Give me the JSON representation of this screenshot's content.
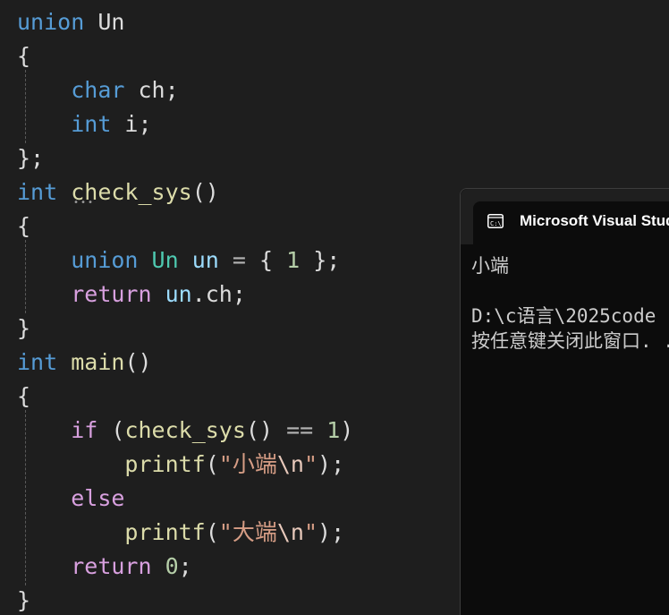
{
  "editor": {
    "lines": [
      [
        {
          "t": "union",
          "c": "kw"
        },
        {
          "t": " ",
          "c": "pl"
        },
        {
          "t": "Un",
          "c": "pl"
        }
      ],
      [
        {
          "t": "{",
          "c": "pl"
        }
      ],
      [
        {
          "t": "    ",
          "c": "pl"
        },
        {
          "t": "char",
          "c": "kw"
        },
        {
          "t": " ch;",
          "c": "pl"
        }
      ],
      [
        {
          "t": "    ",
          "c": "pl"
        },
        {
          "t": "int",
          "c": "kw"
        },
        {
          "t": " i;",
          "c": "pl"
        }
      ],
      [
        {
          "t": "};",
          "c": "pl"
        }
      ],
      [
        {
          "t": "int",
          "c": "kw"
        },
        {
          "t": " ",
          "c": "pl"
        },
        {
          "t": "check_sys",
          "c": "fn"
        },
        {
          "t": "()",
          "c": "pl"
        }
      ],
      [
        {
          "t": "{",
          "c": "pl"
        }
      ],
      [
        {
          "t": "    ",
          "c": "pl"
        },
        {
          "t": "union",
          "c": "kw"
        },
        {
          "t": " ",
          "c": "pl"
        },
        {
          "t": "Un",
          "c": "ty"
        },
        {
          "t": " ",
          "c": "pl"
        },
        {
          "t": "un",
          "c": "var"
        },
        {
          "t": " ",
          "c": "pl"
        },
        {
          "t": "=",
          "c": "op"
        },
        {
          "t": " { ",
          "c": "pl"
        },
        {
          "t": "1",
          "c": "num"
        },
        {
          "t": " };",
          "c": "pl"
        }
      ],
      [
        {
          "t": "    ",
          "c": "pl"
        },
        {
          "t": "return",
          "c": "ctl"
        },
        {
          "t": " ",
          "c": "pl"
        },
        {
          "t": "un",
          "c": "var"
        },
        {
          "t": ".ch;",
          "c": "pl"
        }
      ],
      [
        {
          "t": "}",
          "c": "pl"
        }
      ],
      [
        {
          "t": "int",
          "c": "kw"
        },
        {
          "t": " ",
          "c": "pl"
        },
        {
          "t": "main",
          "c": "fn"
        },
        {
          "t": "()",
          "c": "pl"
        }
      ],
      [
        {
          "t": "{",
          "c": "pl"
        }
      ],
      [
        {
          "t": "    ",
          "c": "pl"
        },
        {
          "t": "if",
          "c": "ctl"
        },
        {
          "t": " (",
          "c": "pl"
        },
        {
          "t": "check_sys",
          "c": "fn"
        },
        {
          "t": "() ",
          "c": "pl"
        },
        {
          "t": "==",
          "c": "op"
        },
        {
          "t": " ",
          "c": "pl"
        },
        {
          "t": "1",
          "c": "num"
        },
        {
          "t": ")",
          "c": "pl"
        }
      ],
      [
        {
          "t": "        ",
          "c": "pl"
        },
        {
          "t": "printf",
          "c": "fn"
        },
        {
          "t": "(",
          "c": "pl"
        },
        {
          "t": "\"小端",
          "c": "str"
        },
        {
          "t": "\\n",
          "c": "esc"
        },
        {
          "t": "\"",
          "c": "str"
        },
        {
          "t": ");",
          "c": "pl"
        }
      ],
      [
        {
          "t": "    ",
          "c": "pl"
        },
        {
          "t": "else",
          "c": "ctl"
        }
      ],
      [
        {
          "t": "        ",
          "c": "pl"
        },
        {
          "t": "printf",
          "c": "fn"
        },
        {
          "t": "(",
          "c": "pl"
        },
        {
          "t": "\"大端",
          "c": "str"
        },
        {
          "t": "\\n",
          "c": "esc"
        },
        {
          "t": "\"",
          "c": "str"
        },
        {
          "t": ");",
          "c": "pl"
        }
      ],
      [
        {
          "t": "    ",
          "c": "pl"
        },
        {
          "t": "return",
          "c": "ctl"
        },
        {
          "t": " ",
          "c": "pl"
        },
        {
          "t": "0",
          "c": "num"
        },
        {
          "t": ";",
          "c": "pl"
        }
      ],
      [
        {
          "t": "}",
          "c": "pl"
        }
      ]
    ]
  },
  "console": {
    "icon": "console-app-icon",
    "title": "Microsoft Visual Studio Debug Console",
    "output": [
      "小端",
      "",
      "D:\\c语言\\2025code",
      "按任意键关闭此窗口. . ."
    ]
  },
  "colors": {
    "background": "#1e1e1e",
    "keyword": "#569cd6",
    "control": "#d8a0df",
    "type": "#4ec9b0",
    "function": "#dcdcaa",
    "variable": "#9cdcfe",
    "number": "#b5cea8",
    "string": "#d69d85",
    "console_background": "#0c0c0c"
  }
}
